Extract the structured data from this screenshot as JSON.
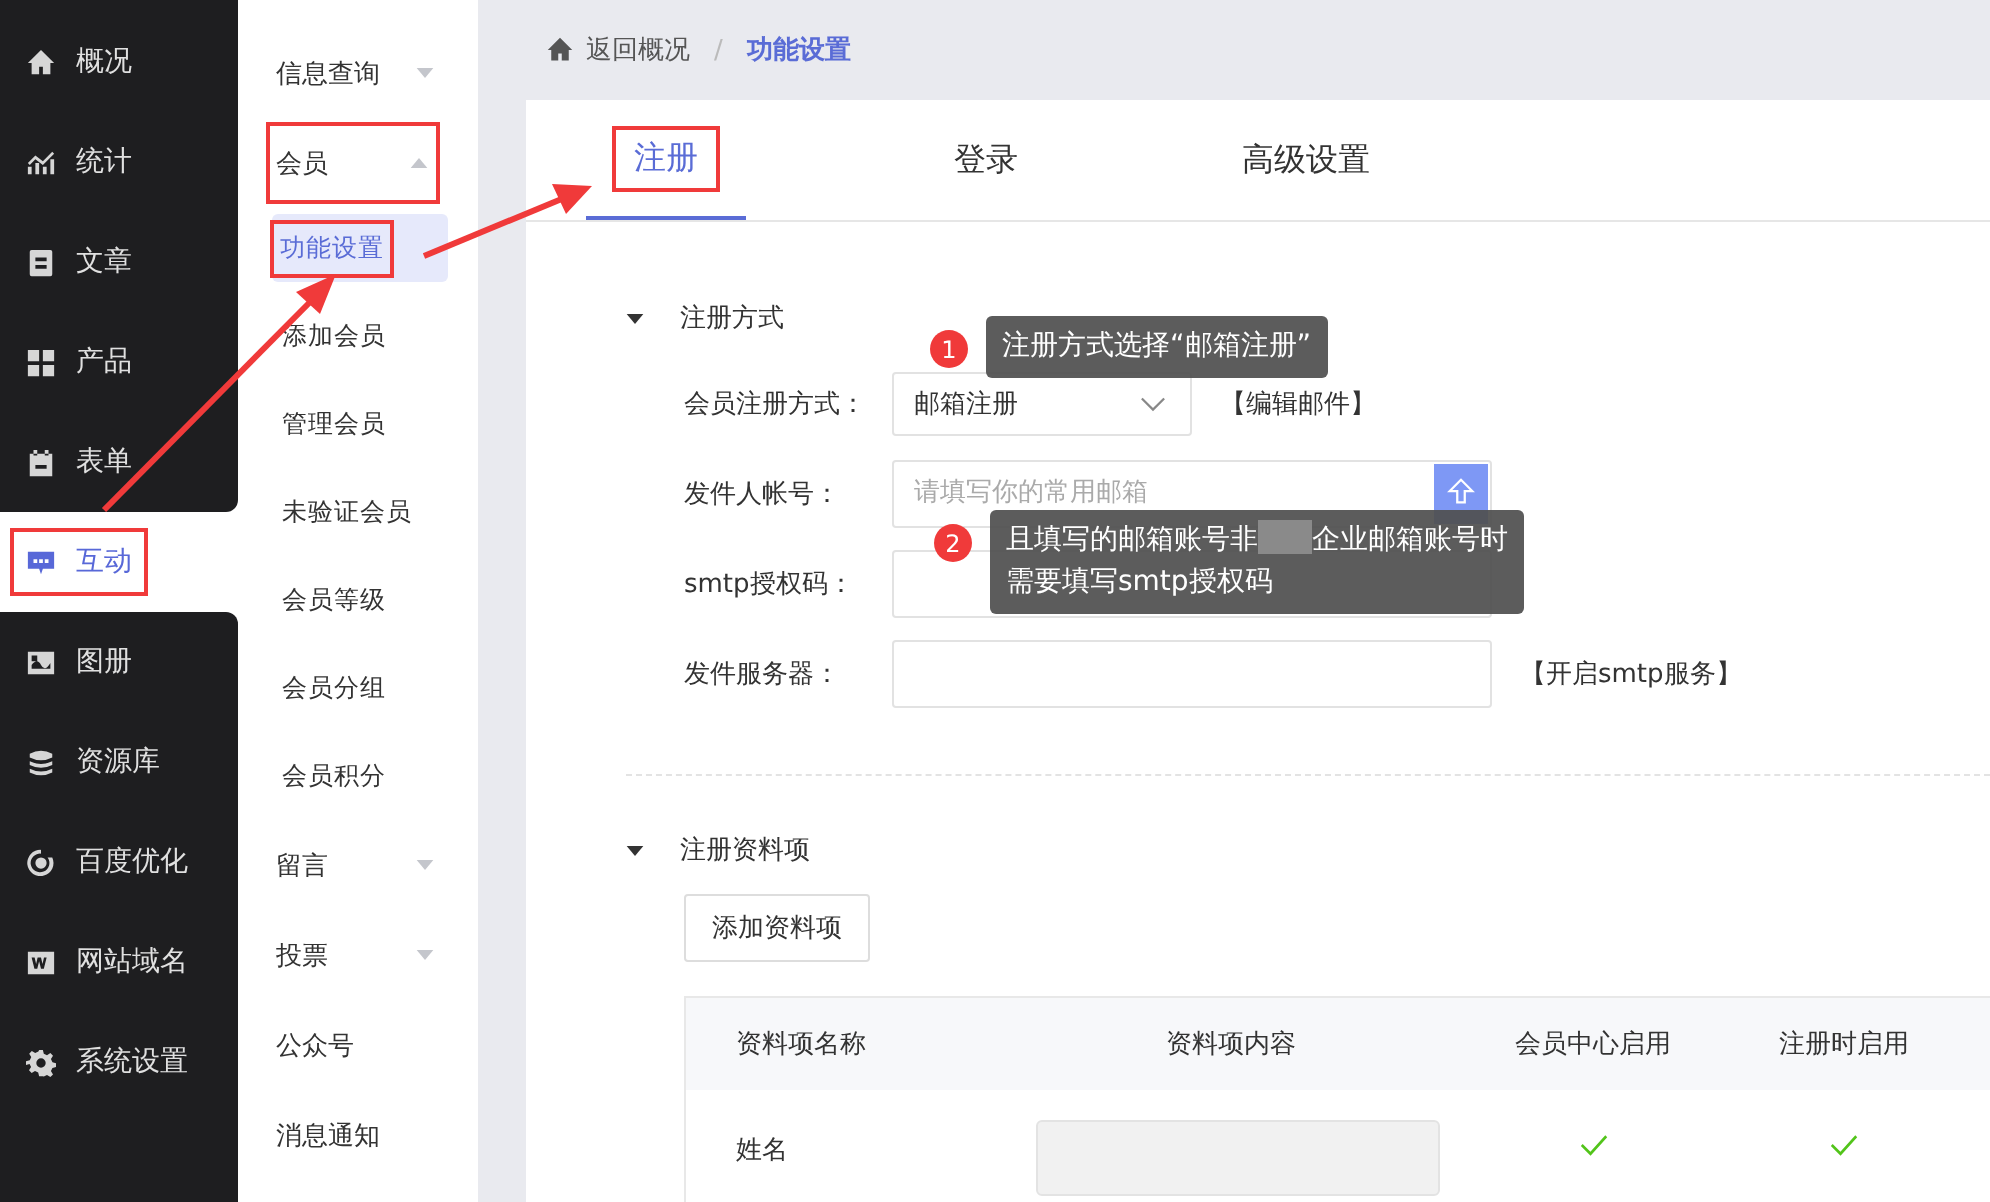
{
  "sidebar": {
    "items": [
      {
        "label": "概况",
        "selected": false,
        "annotated": false
      },
      {
        "label": "统计",
        "selected": false,
        "annotated": false
      },
      {
        "label": "文章",
        "selected": false,
        "annotated": false
      },
      {
        "label": "产品",
        "selected": false,
        "annotated": false
      },
      {
        "label": "表单",
        "selected": false,
        "annotated": false
      },
      {
        "label": "互动",
        "selected": true,
        "annotated": true
      },
      {
        "label": "图册",
        "selected": false,
        "annotated": false
      },
      {
        "label": "资源库",
        "selected": false,
        "annotated": false
      },
      {
        "label": "百度优化",
        "selected": false,
        "annotated": false
      },
      {
        "label": "网站域名",
        "selected": false,
        "annotated": false
      },
      {
        "label": "系统设置",
        "selected": false,
        "annotated": false
      }
    ]
  },
  "submenu": {
    "items": [
      {
        "label": "信息查询",
        "kind": "group",
        "expanded": false,
        "annotated": false
      },
      {
        "label": "会员",
        "kind": "group",
        "expanded": true,
        "annotated": true,
        "children": [
          {
            "label": "功能设置",
            "selected": true,
            "annotated": true
          },
          {
            "label": "添加会员",
            "selected": false,
            "annotated": false
          },
          {
            "label": "管理会员",
            "selected": false,
            "annotated": false
          },
          {
            "label": "未验证会员",
            "selected": false,
            "annotated": false
          },
          {
            "label": "会员等级",
            "selected": false,
            "annotated": false
          },
          {
            "label": "会员分组",
            "selected": false,
            "annotated": false
          },
          {
            "label": "会员积分",
            "selected": false,
            "annotated": false
          }
        ]
      },
      {
        "label": "留言",
        "kind": "group",
        "expanded": false,
        "annotated": false
      },
      {
        "label": "投票",
        "kind": "group",
        "expanded": false,
        "annotated": false
      },
      {
        "label": "公众号",
        "kind": "link",
        "annotated": false
      },
      {
        "label": "消息通知",
        "kind": "link",
        "annotated": false
      }
    ]
  },
  "breadcrumb": {
    "back": "返回概况",
    "separator": "/",
    "current": "功能设置"
  },
  "tabs": [
    {
      "label": "注册",
      "selected": true,
      "annotated": true
    },
    {
      "label": "登录",
      "selected": false,
      "annotated": false
    },
    {
      "label": "高级设置",
      "selected": false,
      "annotated": false
    }
  ],
  "section_1": {
    "title": "注册方式",
    "expanded": true,
    "fields": [
      {
        "kind": "select",
        "label": "会员注册方式：",
        "value": "邮箱注册",
        "link": "【编辑邮件】"
      },
      {
        "kind": "input",
        "label": "发件人帐号：",
        "placeholder": "请填写你的常用邮箱",
        "button": true
      },
      {
        "kind": "input",
        "label": "smtp授权码："
      },
      {
        "kind": "input",
        "label": "发件服务器：",
        "link": "【开启smtp服务】"
      }
    ]
  },
  "tooltips": [
    {
      "number": "1",
      "text": "注册方式选择“邮箱注册”"
    },
    {
      "number": "2",
      "text_before": "且填写的邮箱账号非",
      "text_after": "企业邮箱账号时",
      "text_line2": "需要填写smtp授权码"
    }
  ],
  "section_2": {
    "title": "注册资料项",
    "expanded": true,
    "add_button": "添加资料项",
    "table": {
      "columns": [
        "资料项名称",
        "资料项内容",
        "会员中心启用",
        "注册时启用"
      ],
      "rows": [
        {
          "name": "姓名",
          "member_center": true,
          "on_register": true
        }
      ]
    }
  }
}
